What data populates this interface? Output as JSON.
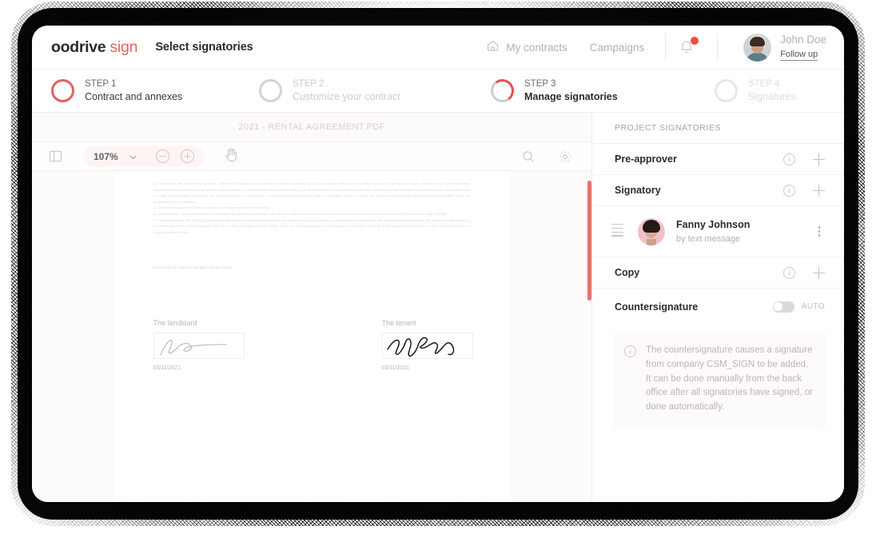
{
  "brand": {
    "name_dark": "oodrive",
    "name_accent": "sign",
    "accent_color": "#e8635e"
  },
  "header": {
    "page_title": "Select signatories",
    "nav": [
      {
        "label": "My contracts",
        "icon": "home-icon"
      },
      {
        "label": "Campaigns",
        "icon": null
      }
    ],
    "notification": {
      "icon": "bell-icon",
      "has_badge": true,
      "badge_color": "#ef4b42"
    },
    "user": {
      "name": "John Doe",
      "action": "Follow up",
      "avatar": "user-avatar"
    }
  },
  "steps": [
    {
      "key": "STEP 1",
      "label": "Contract and annexes",
      "state": "done"
    },
    {
      "key": "STEP 2",
      "label": "Customize your contract",
      "state": "pending"
    },
    {
      "key": "STEP 3",
      "label": "Manage signatories",
      "state": "active"
    },
    {
      "key": "STEP 4",
      "label": "Signatures",
      "state": "future"
    }
  ],
  "viewer": {
    "document_name": "2021 - RENTAL AGREEMENT.PDF",
    "toolbar": {
      "sidebar_toggle": "panel-toggle-icon",
      "zoom_level": "107%",
      "zoom_out": "zoom-out-icon",
      "zoom_in": "zoom-in-icon",
      "pan_tool": "hand-icon",
      "search": "search-icon",
      "settings": "gear-icon"
    },
    "document": {
      "paragraphs": [
        "13. Termination and vacating the premises.  This Rental Property Lease Agreement can be terminated on 30-day advance written notice by either party.  If Tenant fails to comply with the terms of this agreement, misrepresented any material fact on Tenant's rental application, or rental payment has not been made by the fifth business day of the calendar month, this Agreement can be terminated by the Landlord, with appropriate notice to Tenant and procedures required by law.  Upon termination of this tenancy, Tenant will promptly vacate and clean the premises, return all keys to the Landlord, and have the Landlord inspect the Rental Property for compliance with this obligation.",
        "14. Additional provisions.  Additional provisions to this Agreement are the following:",
        "16. Applicable law.  This Agreement will be constructed and governed by the laws of the State of [State] and the venue of any dispute over this Agreement will be in the County of [County] in the State of [State].",
        "17. Entire agreement.  This Rental Property Lease Agreement is entire agreement between the parties.  Any prior negotiations or discussions of terms between the Landlord and with respect to this tenancy are superceded by this written agreement. Any modifications must be in writing and signed by both parties. There are no understandings, representations or warranties except as herein expressly set forth and no rights are granted except as expressly set forth herein."
      ],
      "execution_line": "Executed by the Parties on the dates indicated below.",
      "signature_blocks": [
        {
          "label": "The landloard",
          "date": "03/11/2021",
          "signed": true
        },
        {
          "label": "The tenant",
          "date": "03/11/2021",
          "signed": true
        }
      ]
    }
  },
  "panel": {
    "title": "PROJECT SIGNATORIES",
    "rows": [
      {
        "label": "Pre-approver",
        "info_icon": "info-icon",
        "add_icon": "plus-icon"
      },
      {
        "label": "Signatory",
        "info_icon": "info-icon",
        "add_icon": "plus-icon"
      }
    ],
    "signatory": {
      "name": "Fanny Johnson",
      "method": "by text message",
      "drag_handle": "drag-handle-icon",
      "menu": "more-options-icon"
    },
    "copy_row": {
      "label": "Copy",
      "info_icon": "info-icon",
      "add_icon": "plus-icon"
    },
    "countersignature": {
      "label": "Countersignature",
      "toggle_label": "AUTO",
      "toggle_on": false,
      "info": "The countersignature causes a signature from company CSM_SIGN to be added. It can be done manually from the back office after all signatories have signed, or done automatically."
    }
  }
}
